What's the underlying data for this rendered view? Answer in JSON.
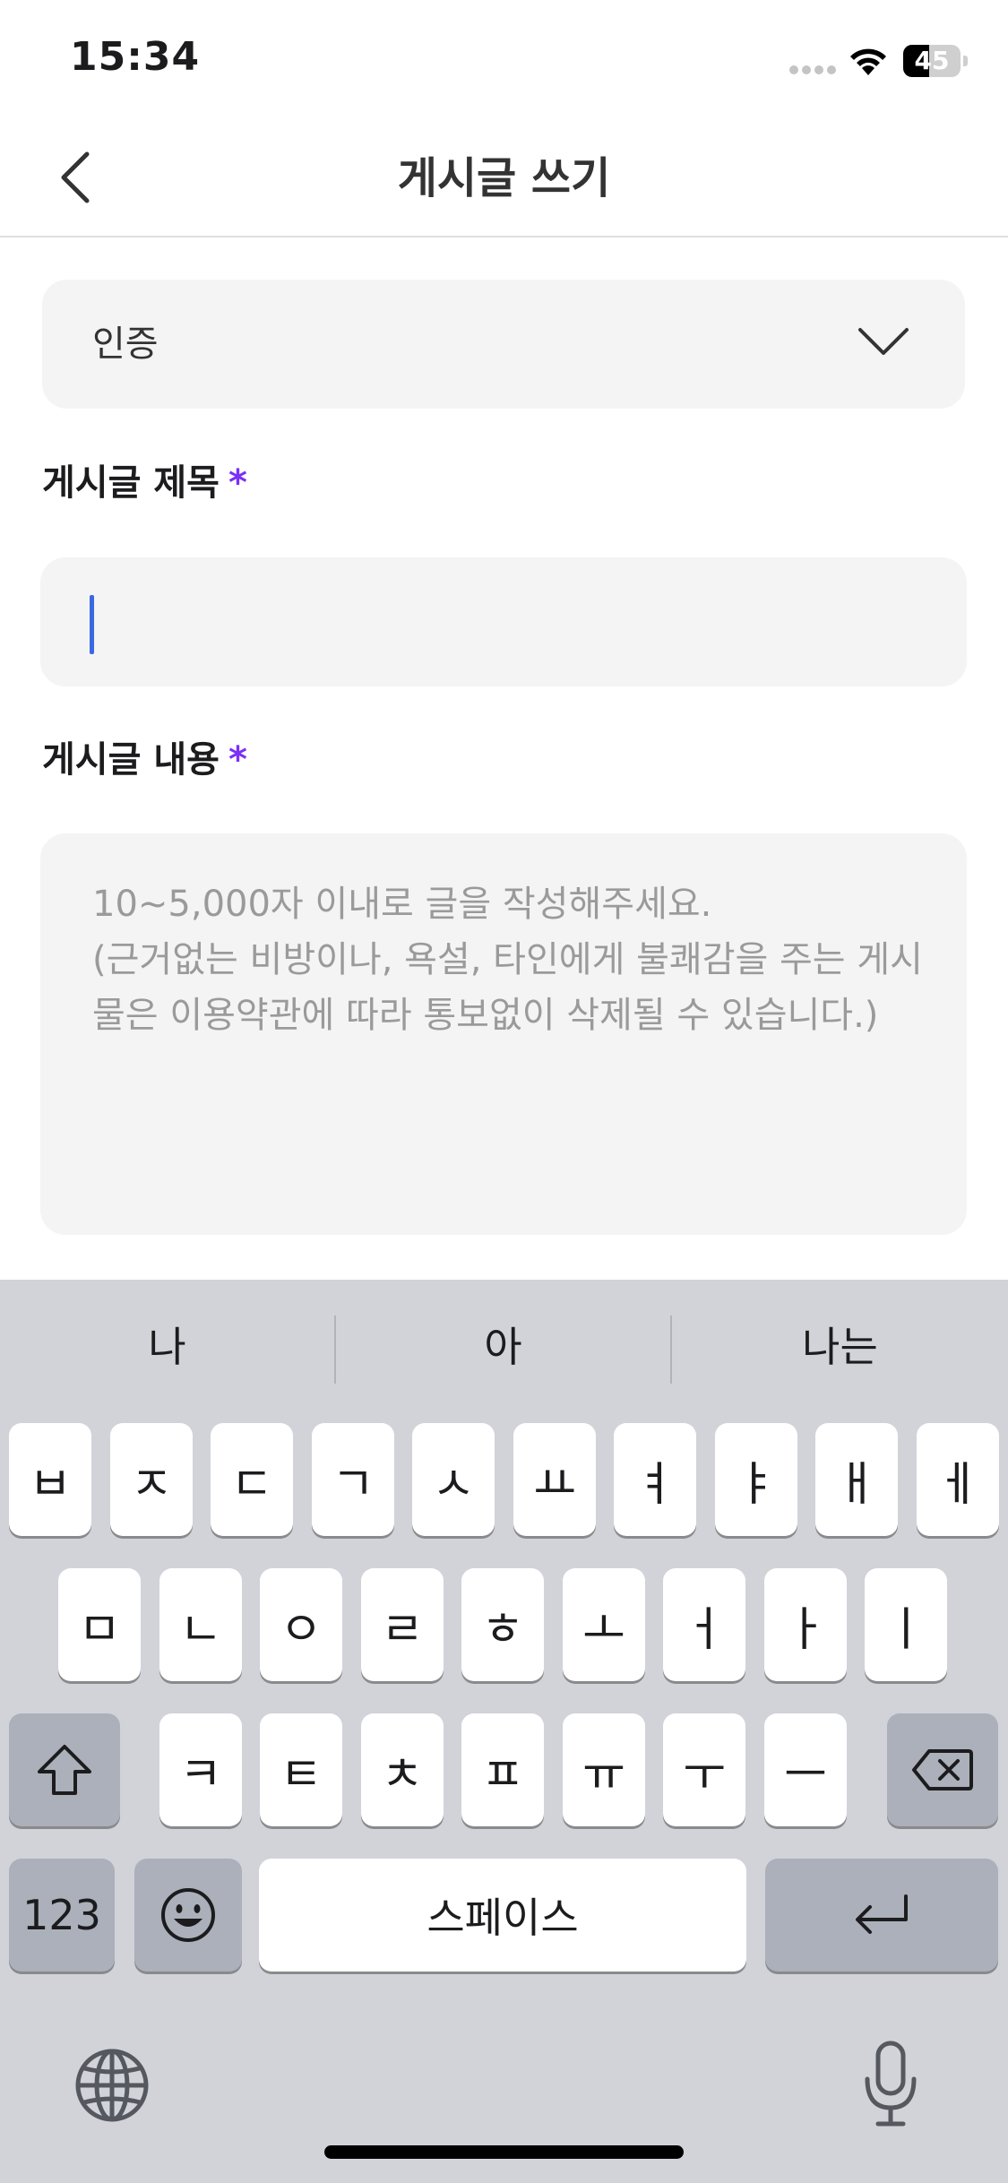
{
  "status_bar": {
    "time": "15:34",
    "battery_level": "45",
    "battery_fraction": 0.45,
    "signal_icon": "signal-dots-icon",
    "wifi_icon": "wifi-icon"
  },
  "nav": {
    "back_icon": "chevron-left-icon",
    "title": "게시글 쓰기"
  },
  "form": {
    "category": {
      "selected": "인증",
      "icon": "chevron-down-icon"
    },
    "title_field": {
      "label": "게시글 제목",
      "required_mark": "*",
      "value": ""
    },
    "content_field": {
      "label": "게시글 내용",
      "required_mark": "*",
      "placeholder": "10~5,000자 이내로 글을 작성해주세요.\n(근거없는 비방이나, 욕설, 타인에게 불쾌감을 주는 게시물은 이용약관에 따라 통보없이 삭제될 수 있습니다.)"
    }
  },
  "colors": {
    "accent_required": "#7b2ff7",
    "cursor": "#3b67e0",
    "input_background": "#f4f4f5",
    "keyboard_background": "#d1d3d9"
  },
  "keyboard": {
    "suggestions": [
      "나",
      "아",
      "나는"
    ],
    "row1": [
      "ㅂ",
      "ㅈ",
      "ㄷ",
      "ㄱ",
      "ㅅ",
      "ㅛ",
      "ㅕ",
      "ㅑ",
      "ㅐ",
      "ㅔ"
    ],
    "row2": [
      "ㅁ",
      "ㄴ",
      "ㅇ",
      "ㄹ",
      "ㅎ",
      "ㅗ",
      "ㅓ",
      "ㅏ",
      "ㅣ"
    ],
    "row3": [
      "ㅋ",
      "ㅌ",
      "ㅊ",
      "ㅍ",
      "ㅠ",
      "ㅜ",
      "ㅡ"
    ],
    "shift_icon": "shift-icon",
    "delete_icon": "backspace-icon",
    "numbers_label": "123",
    "emoji_icon": "emoji-icon",
    "space_label": "스페이스",
    "return_icon": "return-icon",
    "globe_icon": "globe-icon",
    "mic_icon": "microphone-icon"
  }
}
